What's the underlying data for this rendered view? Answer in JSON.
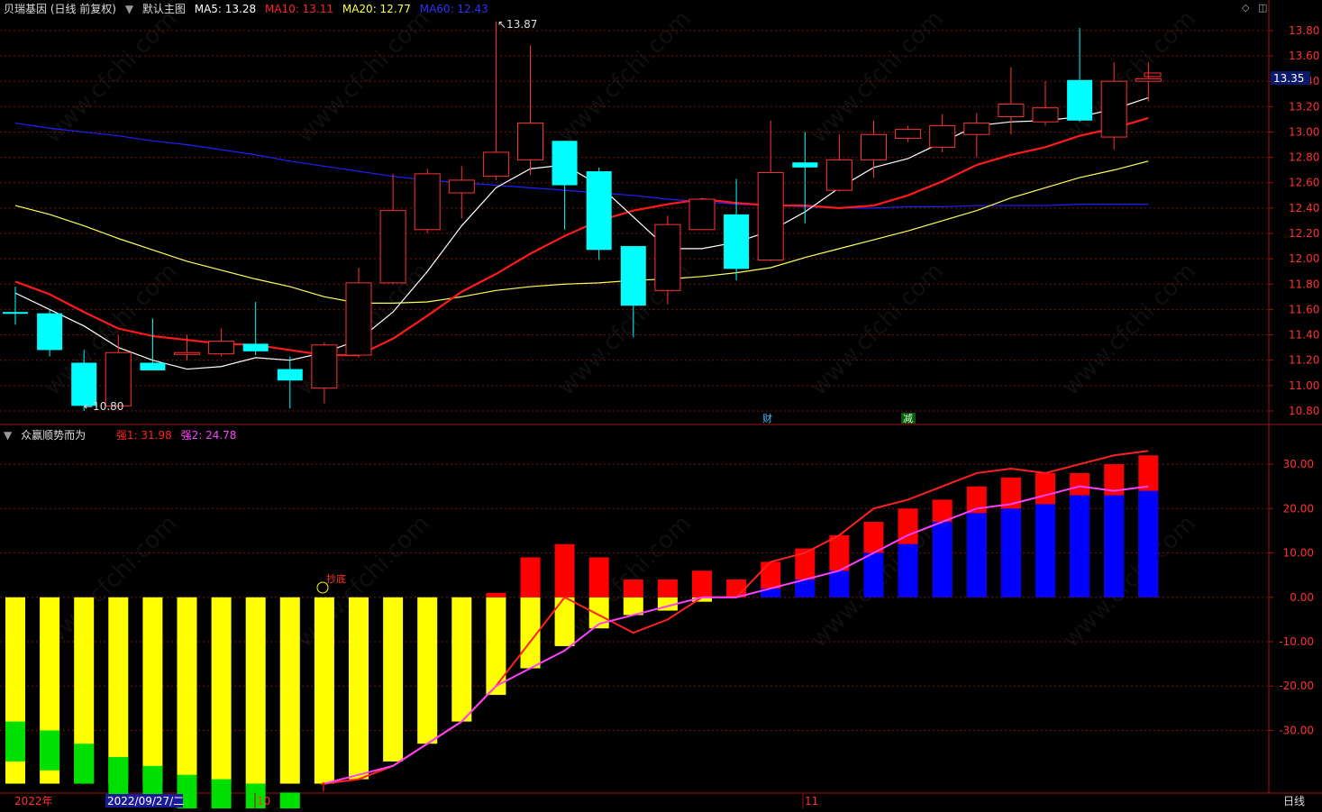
{
  "header": {
    "title": "贝瑞基因 (日线 前复权)",
    "main_indicator": "默认主图",
    "ma5": {
      "label": "MA5: 13.28",
      "color": "#ffffff"
    },
    "ma10": {
      "label": "MA10: 13.11",
      "color": "#ff2020"
    },
    "ma20": {
      "label": "MA20: 12.77",
      "color": "#ffff40"
    },
    "ma60": {
      "label": "MA60: 12.43",
      "color": "#3030ff"
    }
  },
  "sub_header": {
    "title": "众赢顺势而为",
    "q1": {
      "label": "强1: 31.98",
      "color": "#ff2020"
    },
    "q2": {
      "label": "强2: 24.78",
      "color": "#ff40ff"
    }
  },
  "annotations": {
    "high": "13.87",
    "low": "10.80",
    "current_price": "13.35",
    "cai": "财",
    "jian": "减",
    "chaodi": "抄底"
  },
  "xaxis": {
    "year": "2022年",
    "date": "2022/09/27/二",
    "oct": "10",
    "nov": "11",
    "period": "日线"
  },
  "colors": {
    "up": "#ff3232",
    "down": "#00ffff",
    "ma5": "#ffffff",
    "ma10": "#ff1a1a",
    "ma20": "#ffff55",
    "ma60": "#2020ff"
  },
  "watermark": "www.cfchi.com",
  "chart_data": [
    {
      "type": "candlestick",
      "ylim": [
        10.75,
        13.92
      ],
      "y_ticks": [
        "13.80",
        "13.60",
        "13.40",
        "13.20",
        "13.00",
        "12.80",
        "12.60",
        "12.40",
        "12.20",
        "12.00",
        "11.80",
        "11.60",
        "11.40",
        "11.20",
        "11.00",
        "10.80"
      ],
      "candles": [
        {
          "o": 11.58,
          "h": 11.78,
          "l": 11.48,
          "c": 11.57
        },
        {
          "o": 11.57,
          "h": 11.6,
          "l": 11.23,
          "c": 11.28
        },
        {
          "o": 11.18,
          "h": 11.28,
          "l": 10.8,
          "c": 10.84
        },
        {
          "o": 10.84,
          "h": 11.4,
          "l": 10.82,
          "c": 11.26
        },
        {
          "o": 11.18,
          "h": 11.53,
          "l": 11.12,
          "c": 11.12
        },
        {
          "o": 11.25,
          "h": 11.4,
          "l": 11.2,
          "c": 11.26
        },
        {
          "o": 11.25,
          "h": 11.45,
          "l": 11.23,
          "c": 11.35
        },
        {
          "o": 11.33,
          "h": 11.66,
          "l": 11.24,
          "c": 11.27
        },
        {
          "o": 11.13,
          "h": 11.23,
          "l": 10.82,
          "c": 11.04
        },
        {
          "o": 10.98,
          "h": 11.34,
          "l": 10.86,
          "c": 11.32
        },
        {
          "o": 11.24,
          "h": 11.93,
          "l": 11.22,
          "c": 11.81
        },
        {
          "o": 11.81,
          "h": 12.67,
          "l": 11.8,
          "c": 12.38
        },
        {
          "o": 12.23,
          "h": 12.71,
          "l": 12.2,
          "c": 12.67
        },
        {
          "o": 12.52,
          "h": 12.73,
          "l": 12.32,
          "c": 12.62
        },
        {
          "o": 12.65,
          "h": 13.87,
          "l": 12.62,
          "c": 12.84
        },
        {
          "o": 12.78,
          "h": 13.68,
          "l": 12.66,
          "c": 13.07
        },
        {
          "o": 12.93,
          "h": 12.93,
          "l": 12.23,
          "c": 12.58
        },
        {
          "o": 12.69,
          "h": 12.72,
          "l": 11.99,
          "c": 12.07
        },
        {
          "o": 12.1,
          "h": 12.1,
          "l": 11.38,
          "c": 11.63
        },
        {
          "o": 11.75,
          "h": 12.34,
          "l": 11.64,
          "c": 12.27
        },
        {
          "o": 12.23,
          "h": 12.48,
          "l": 12.23,
          "c": 12.47
        },
        {
          "o": 12.35,
          "h": 12.63,
          "l": 11.83,
          "c": 11.92
        },
        {
          "o": 11.99,
          "h": 13.09,
          "l": 11.98,
          "c": 12.68
        },
        {
          "o": 12.76,
          "h": 13.0,
          "l": 12.28,
          "c": 12.72
        },
        {
          "o": 12.54,
          "h": 12.98,
          "l": 12.53,
          "c": 12.78
        },
        {
          "o": 12.78,
          "h": 13.09,
          "l": 12.64,
          "c": 12.98
        },
        {
          "o": 12.95,
          "h": 13.05,
          "l": 12.92,
          "c": 13.02
        },
        {
          "o": 12.88,
          "h": 13.14,
          "l": 12.84,
          "c": 13.05
        },
        {
          "o": 12.98,
          "h": 13.15,
          "l": 12.8,
          "c": 13.07
        },
        {
          "o": 13.12,
          "h": 13.51,
          "l": 12.98,
          "c": 13.22
        },
        {
          "o": 13.08,
          "h": 13.4,
          "l": 13.05,
          "c": 13.19
        },
        {
          "o": 13.41,
          "h": 13.82,
          "l": 13.08,
          "c": 13.09
        },
        {
          "o": 12.96,
          "h": 13.55,
          "l": 12.86,
          "c": 13.4
        },
        {
          "o": 13.4,
          "h": 13.55,
          "l": 13.24,
          "c": 13.42
        }
      ],
      "ma5": [
        11.73,
        11.6,
        11.47,
        11.3,
        11.2,
        11.13,
        11.15,
        11.22,
        11.2,
        11.26,
        11.36,
        11.58,
        11.9,
        12.26,
        12.56,
        12.71,
        12.74,
        12.58,
        12.33,
        12.08,
        12.08,
        12.13,
        12.22,
        12.37,
        12.56,
        12.72,
        12.79,
        12.92,
        13.05,
        13.08,
        13.09,
        13.12,
        13.18,
        13.27
      ],
      "ma10": [
        11.82,
        11.72,
        11.58,
        11.45,
        11.39,
        11.36,
        11.33,
        11.32,
        11.28,
        11.24,
        11.24,
        11.37,
        11.55,
        11.74,
        11.88,
        12.04,
        12.18,
        12.3,
        12.38,
        12.43,
        12.47,
        12.44,
        12.42,
        12.42,
        12.4,
        12.42,
        12.5,
        12.61,
        12.74,
        12.82,
        12.88,
        12.97,
        13.03,
        13.11
      ],
      "ma20": [
        12.42,
        12.35,
        12.26,
        12.16,
        12.07,
        11.98,
        11.91,
        11.84,
        11.78,
        11.7,
        11.65,
        11.65,
        11.66,
        11.7,
        11.75,
        11.78,
        11.8,
        11.81,
        11.83,
        11.84,
        11.86,
        11.89,
        11.93,
        12.01,
        12.08,
        12.15,
        12.22,
        12.3,
        12.38,
        12.48,
        12.56,
        12.64,
        12.7,
        12.77
      ],
      "ma60": [
        13.07,
        13.03,
        13.0,
        12.97,
        12.93,
        12.9,
        12.86,
        12.82,
        12.77,
        12.73,
        12.69,
        12.65,
        12.62,
        12.6,
        12.58,
        12.56,
        12.54,
        12.52,
        12.5,
        12.47,
        12.45,
        12.43,
        12.42,
        12.41,
        12.4,
        12.4,
        12.41,
        12.41,
        12.42,
        12.42,
        12.42,
        12.43,
        12.43,
        12.43
      ]
    },
    {
      "type": "bar",
      "ylim": [
        -42.5,
        35.5
      ],
      "y_ticks": [
        "30.00",
        "20.00",
        "10.00",
        "0.00",
        "-10.00",
        "-20.00",
        "-30.00"
      ],
      "q1": [
        -41,
        -41,
        -41,
        -41,
        -41,
        -41,
        -41,
        -41,
        -41,
        -42,
        -41,
        -38,
        -33,
        -28,
        -20,
        -10,
        0,
        -4,
        -8,
        -5,
        0,
        0,
        8,
        10,
        14,
        20,
        22,
        25,
        28,
        29,
        28,
        30,
        32,
        33
      ],
      "q2": [
        -41,
        -41,
        -41,
        -41,
        -41,
        -41,
        -41,
        -41,
        -41,
        -42,
        -40,
        -38,
        -33,
        -28,
        -20,
        -16,
        -12,
        -6,
        -4,
        -2,
        0,
        0,
        2,
        4,
        6,
        10,
        14,
        17,
        20,
        21,
        23,
        25,
        24,
        25
      ],
      "lower_full": [
        -42,
        -42,
        -42,
        -42,
        -42,
        -42,
        -42,
        -42,
        -42,
        -42,
        -41,
        -37,
        -33,
        -28,
        -22,
        -16,
        -11,
        -7,
        -4,
        -3,
        -1,
        0,
        0,
        0,
        0,
        0,
        0,
        0,
        0,
        0,
        0,
        0,
        0,
        0
      ],
      "green_part": [
        -28,
        -30,
        -33,
        -36,
        -38,
        -40,
        -41,
        -42,
        -44,
        null,
        null,
        null,
        null,
        null,
        null,
        null,
        null,
        null,
        null,
        null,
        null,
        null,
        null,
        null,
        null,
        null,
        null,
        null,
        null,
        null,
        null,
        null,
        null,
        null
      ],
      "red_top": [
        0,
        0,
        0,
        0,
        0,
        0,
        0,
        0,
        0,
        0,
        0,
        0,
        0,
        0,
        1,
        9,
        12,
        9,
        4,
        4,
        6,
        4,
        8,
        11,
        14,
        17,
        20,
        22,
        25,
        27,
        28,
        28,
        30,
        32
      ],
      "blue_top": [
        0,
        0,
        0,
        0,
        0,
        0,
        0,
        0,
        0,
        0,
        0,
        0,
        0,
        0,
        0,
        0,
        0,
        0,
        0,
        0,
        0,
        0,
        2,
        4,
        6,
        10,
        12,
        17,
        19,
        20,
        21,
        23,
        23,
        24
      ]
    }
  ]
}
